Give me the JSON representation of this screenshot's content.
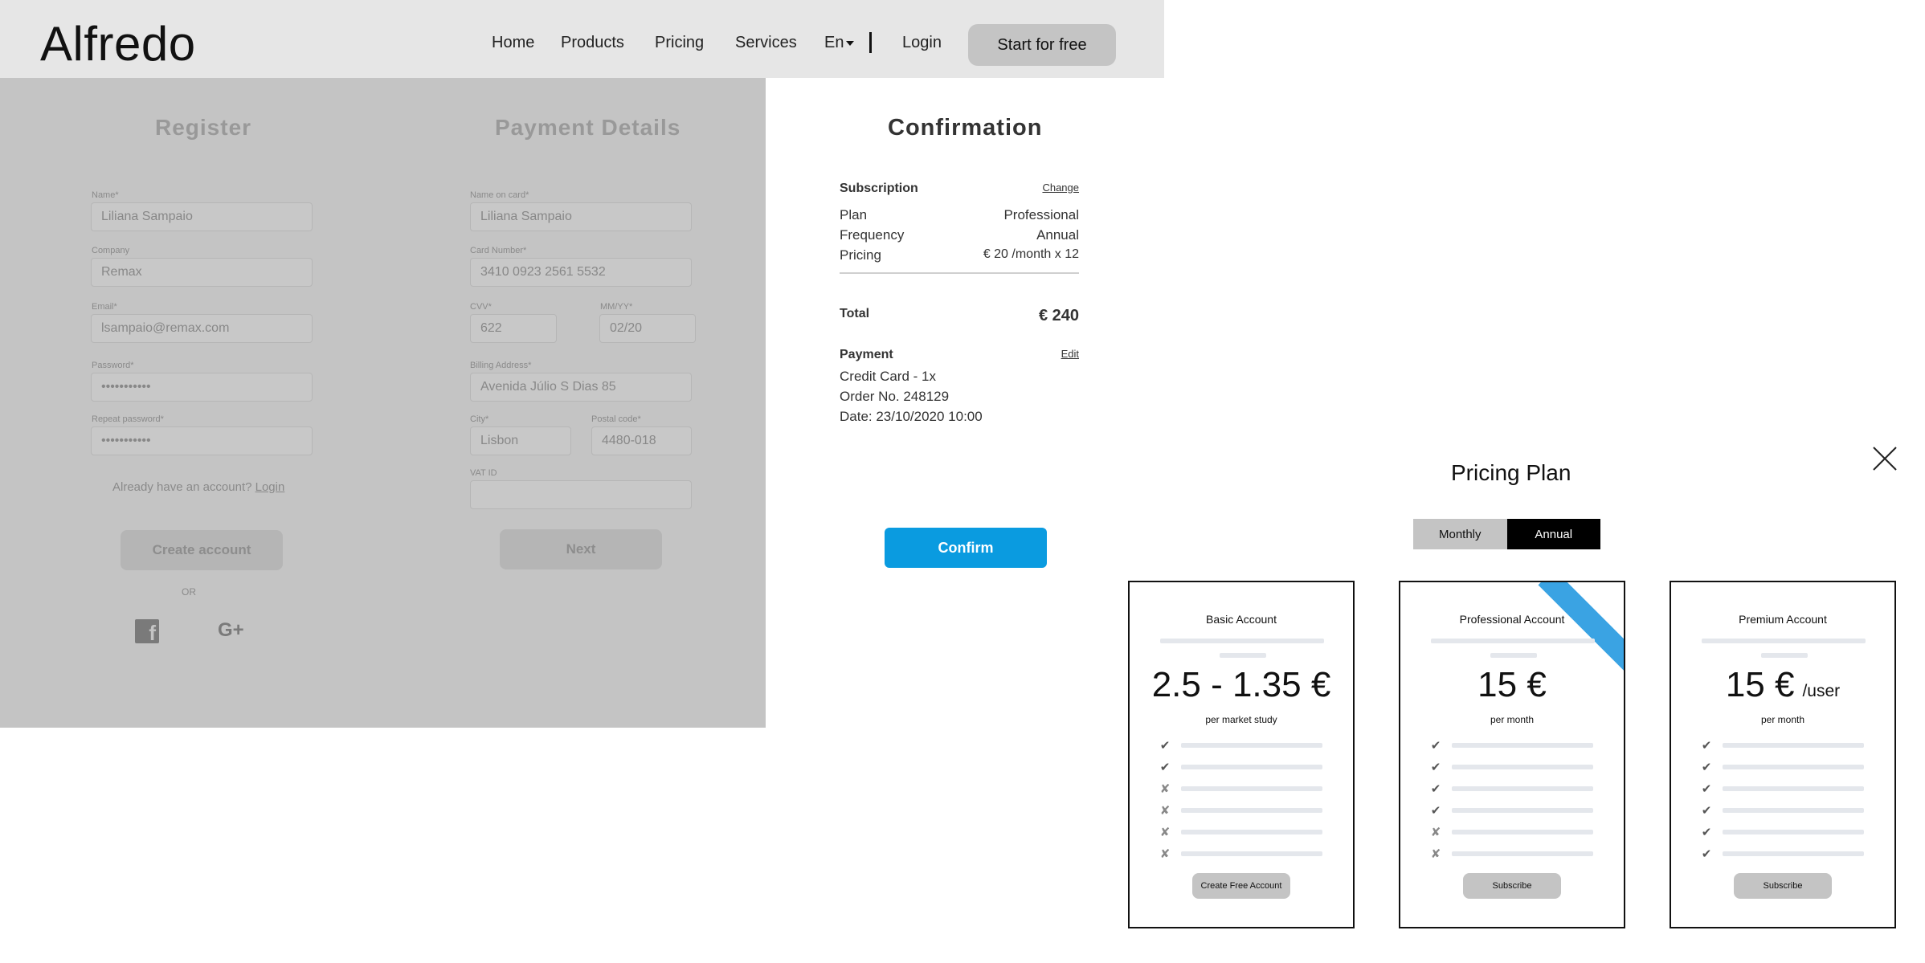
{
  "header": {
    "logo": "Alfredo",
    "nav": [
      "Home",
      "Products",
      "Pricing",
      "Services"
    ],
    "language": "En",
    "login": "Login",
    "start_button": "Start for free"
  },
  "register": {
    "title": "Register",
    "name_label": "Name*",
    "name_value": "Liliana Sampaio",
    "company_label": "Company",
    "company_value": "Remax",
    "email_label": "Email*",
    "email_value": "lsampaio@remax.com",
    "password_label": "Password*",
    "password_value": "•••••••••••",
    "repeat_label": "Repeat password*",
    "repeat_value": "•••••••••••",
    "already_text": "Already have an account?",
    "login_link": "Login",
    "create_button": "Create account",
    "or_text": "OR",
    "facebook_glyph": "f",
    "google_glyph": "G+"
  },
  "payment": {
    "title": "Payment Details",
    "card_name_label": "Name on card*",
    "card_name_value": "Liliana Sampaio",
    "card_number_label": "Card Number*",
    "card_number_value": "3410 0923 2561 5532",
    "cvv_label": "CVV*",
    "cvv_value": "622",
    "expiry_label": "MM/YY*",
    "expiry_value": "02/20",
    "billing_label": "Billing Address*",
    "billing_value": "Avenida Júlio S Dias 85",
    "city_label": "City*",
    "city_value": "Lisbon",
    "postal_label": "Postal code*",
    "postal_value": "4480-018",
    "vat_label": "VAT ID",
    "vat_value": "",
    "next_button": "Next"
  },
  "confirmation": {
    "title": "Confirmation",
    "subscription_heading": "Subscription",
    "change_link": "Change",
    "rows": [
      {
        "label": "Plan",
        "value": "Professional"
      },
      {
        "label": "Frequency",
        "value": "Annual"
      },
      {
        "label": "Pricing",
        "value": "€ 20 /month x 12"
      }
    ],
    "total_label": "Total",
    "total_value": "€ 240",
    "payment_heading": "Payment",
    "edit_link": "Edit",
    "payment_lines": [
      "Credit Card - 1x",
      "Order No. 248129",
      "Date: 23/10/2020 10:00"
    ],
    "confirm_button": "Confirm"
  },
  "pricing": {
    "title": "Pricing Plan",
    "toggle": {
      "monthly": "Monthly",
      "annual": "Annual",
      "selected": "Annual"
    },
    "plans": [
      {
        "name": "Basic Account",
        "price": "2.5 - 1.35 €",
        "price_suffix": "",
        "period": "per market study",
        "features": [
          "check",
          "check",
          "x",
          "x",
          "x",
          "x"
        ],
        "button": "Create Free Account",
        "highlighted": false
      },
      {
        "name": "Professional Account",
        "price": "15 €",
        "price_suffix": "",
        "period": "per month",
        "features": [
          "check",
          "check",
          "check",
          "check",
          "x",
          "x"
        ],
        "button": "Subscribe",
        "highlighted": true
      },
      {
        "name": "Premium Account",
        "price": "15 €",
        "price_suffix": "/user",
        "period": "per month",
        "features": [
          "check",
          "check",
          "check",
          "check",
          "check",
          "check"
        ],
        "button": "Subscribe",
        "highlighted": false
      }
    ]
  },
  "icons": {
    "check": "✔",
    "x": "✘",
    "accent": "#0a9be0",
    "ribbon": "#3aa3e3"
  }
}
